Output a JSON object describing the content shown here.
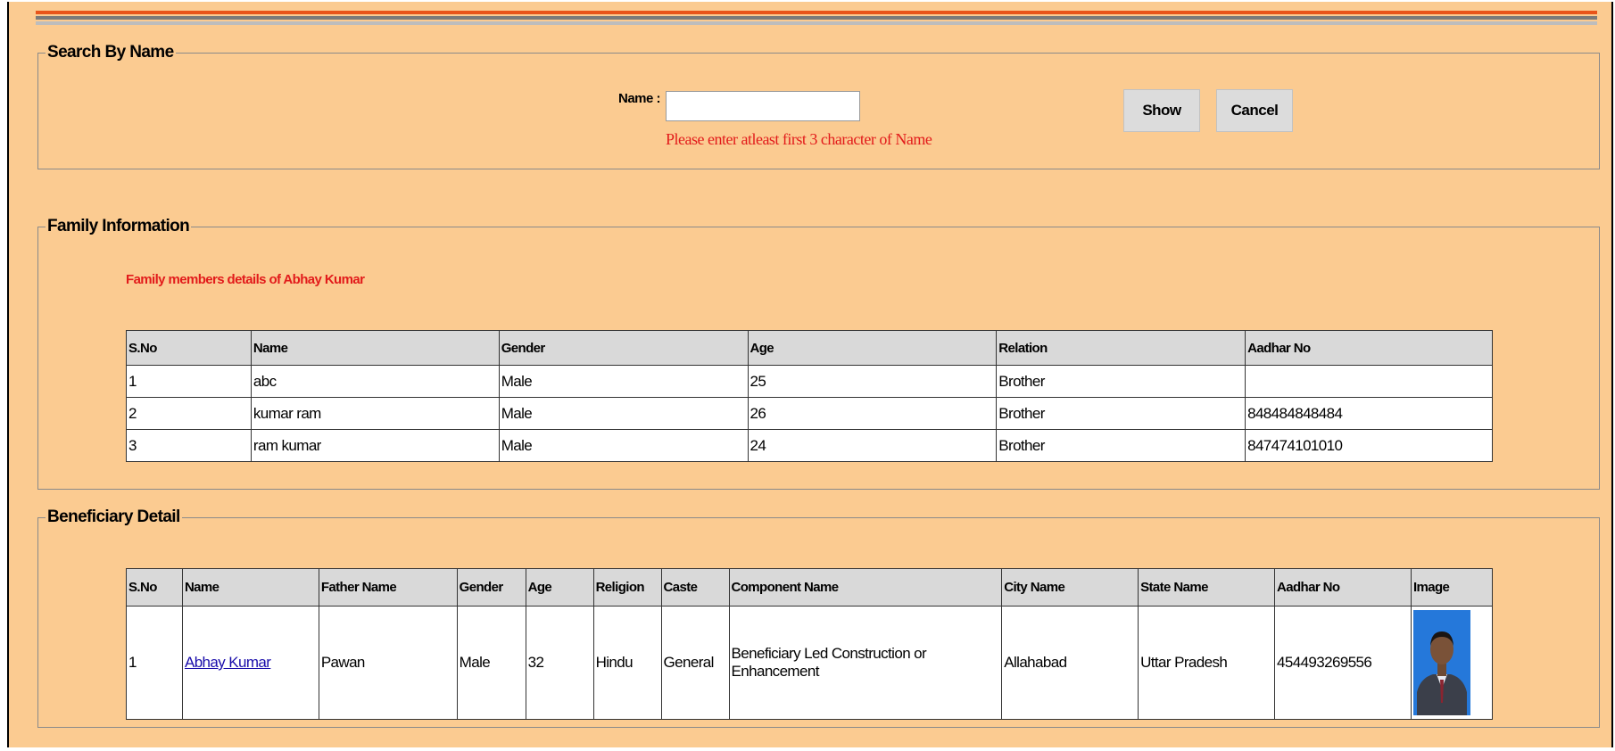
{
  "search": {
    "legend": "Search By Name",
    "name_label": "Name :",
    "name_value": "",
    "hint": "Please enter atleast first 3 character of Name",
    "show_label": "Show",
    "cancel_label": "Cancel"
  },
  "family": {
    "legend": "Family Information",
    "title": "Family members details of Abhay Kumar",
    "headers": [
      "S.No",
      "Name",
      "Gender",
      "Age",
      "Relation",
      "Aadhar No"
    ],
    "rows": [
      [
        "1",
        "abc",
        "Male",
        "25",
        "Brother",
        ""
      ],
      [
        "2",
        "kumar ram",
        "Male",
        "26",
        "Brother",
        "848484848484"
      ],
      [
        "3",
        "ram kumar",
        "Male",
        "24",
        "Brother",
        "847474101010"
      ]
    ]
  },
  "beneficiary": {
    "legend": "Beneficiary Detail",
    "headers": [
      "S.No",
      "Name",
      "Father Name",
      "Gender",
      "Age",
      "Religion",
      "Caste",
      "Component Name",
      "City Name",
      "State Name",
      "Aadhar No",
      "Image"
    ],
    "rows": [
      [
        "1",
        "Abhay Kumar",
        "Pawan",
        "Male",
        "32",
        "Hindu",
        "General",
        "Beneficiary Led Construction or Enhancement",
        "Allahabad",
        "Uttar Pradesh",
        "454493269556",
        ""
      ]
    ]
  },
  "colors": {
    "page_bg": "#fbcb91",
    "stripe_orange": "#e8541a",
    "hint_red": "#e21b1b",
    "header_gray": "#d9d9d9",
    "link_blue": "#1a0dab"
  }
}
